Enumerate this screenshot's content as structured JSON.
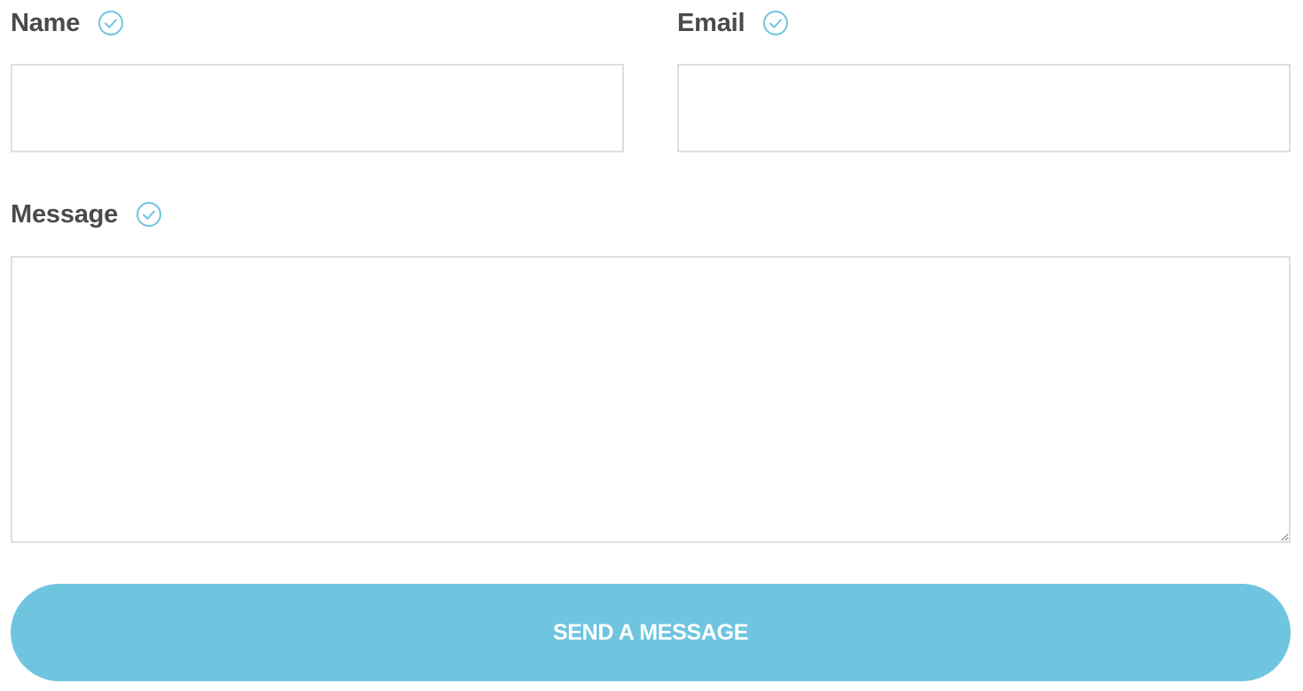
{
  "form": {
    "name_label": "Name",
    "email_label": "Email",
    "message_label": "Message",
    "name_value": "",
    "email_value": "",
    "message_value": "",
    "submit_label": "SEND A MESSAGE"
  },
  "icons": {
    "valid_indicator": "check-circle-icon"
  },
  "colors": {
    "accent": "#6fc5e0",
    "label_text": "#4a4a4a",
    "field_border": "#dedede",
    "button_text": "#ffffff"
  }
}
